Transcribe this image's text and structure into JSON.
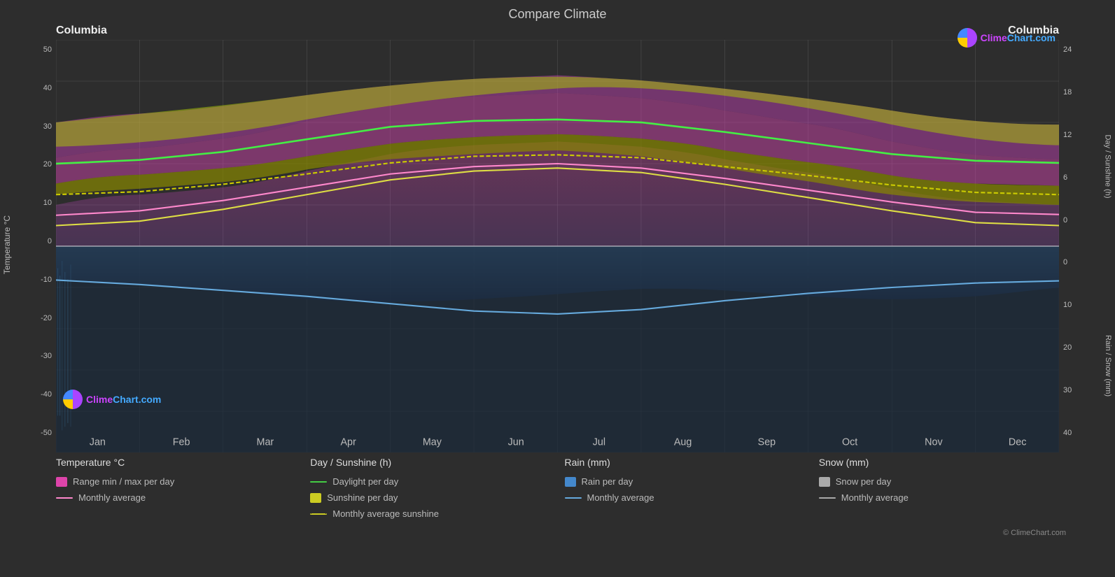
{
  "title": "Compare Climate",
  "location_left": "Columbia",
  "location_right": "Columbia",
  "logo": {
    "text_clime": "Clime",
    "text_chart": "Chart",
    "text_com": ".com",
    "url": "ClimeChart.com"
  },
  "copyright": "© ClimeChart.com",
  "y_axis_left": {
    "label": "Temperature °C",
    "values": [
      "50",
      "40",
      "30",
      "20",
      "10",
      "0",
      "-10",
      "-20",
      "-30",
      "-40",
      "-50"
    ]
  },
  "y_axis_right_sunshine": {
    "label": "Day / Sunshine (h)",
    "values": [
      "24",
      "18",
      "12",
      "6",
      "0"
    ]
  },
  "y_axis_right_rain": {
    "label": "Rain / Snow (mm)",
    "values": [
      "0",
      "10",
      "20",
      "30",
      "40"
    ]
  },
  "x_axis": {
    "months": [
      "Jan",
      "Feb",
      "Mar",
      "Apr",
      "May",
      "Jun",
      "Jul",
      "Aug",
      "Sep",
      "Oct",
      "Nov",
      "Dec"
    ]
  },
  "legend": {
    "temperature": {
      "title": "Temperature °C",
      "items": [
        {
          "type": "swatch",
          "color": "#dd44aa",
          "label": "Range min / max per day"
        },
        {
          "type": "line",
          "color": "#ff88cc",
          "label": "Monthly average"
        }
      ]
    },
    "sunshine": {
      "title": "Day / Sunshine (h)",
      "items": [
        {
          "type": "line",
          "color": "#44cc44",
          "label": "Daylight per day"
        },
        {
          "type": "swatch",
          "color": "#cccc22",
          "label": "Sunshine per day"
        },
        {
          "type": "line",
          "color": "#cccc22",
          "label": "Monthly average sunshine"
        }
      ]
    },
    "rain": {
      "title": "Rain (mm)",
      "items": [
        {
          "type": "swatch",
          "color": "#4488cc",
          "label": "Rain per day"
        },
        {
          "type": "line",
          "color": "#66aadd",
          "label": "Monthly average"
        }
      ]
    },
    "snow": {
      "title": "Snow (mm)",
      "items": [
        {
          "type": "swatch",
          "color": "#aaaaaa",
          "label": "Snow per day"
        },
        {
          "type": "line",
          "color": "#aaaaaa",
          "label": "Monthly average"
        }
      ]
    }
  }
}
